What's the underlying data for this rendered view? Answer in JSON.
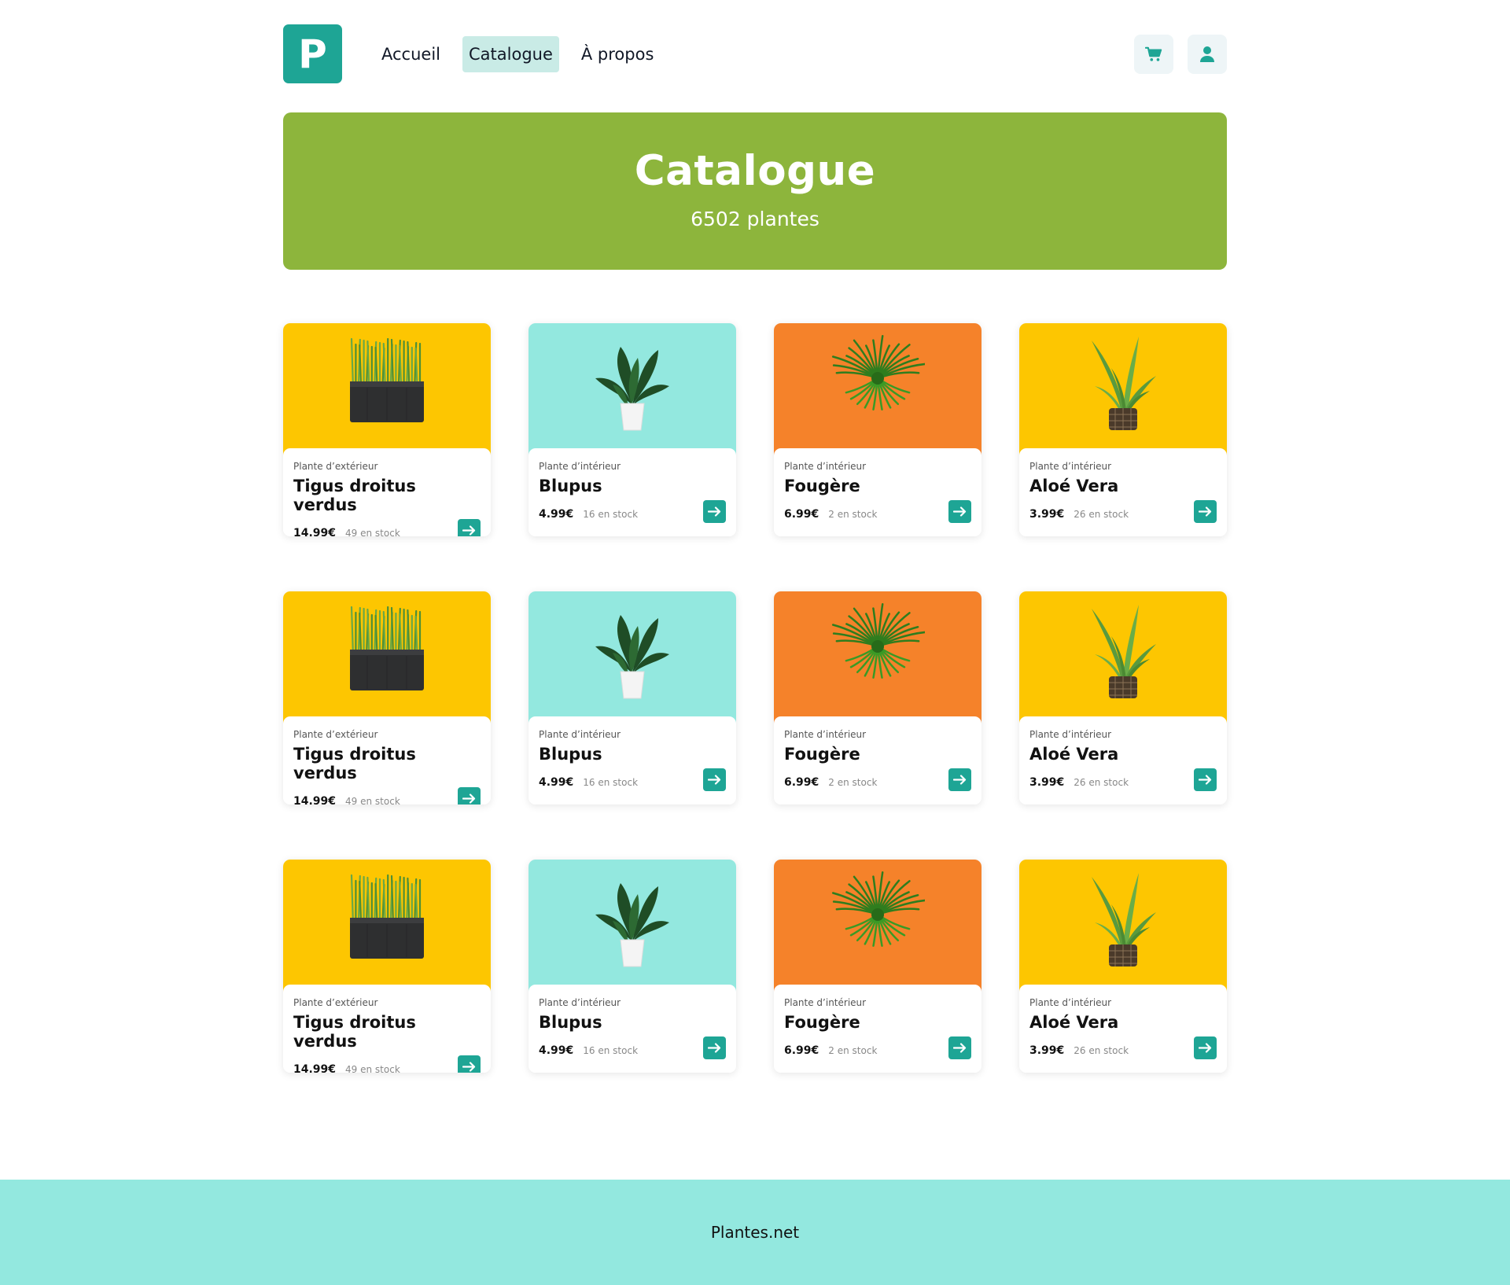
{
  "header": {
    "logo_letter": "P",
    "nav": [
      {
        "label": "Accueil",
        "active": false
      },
      {
        "label": "Catalogue",
        "active": true
      },
      {
        "label": "À propos",
        "active": false
      }
    ],
    "icons": [
      "cart-icon",
      "user-icon"
    ]
  },
  "banner": {
    "title": "Catalogue",
    "subtitle": "6502 plantes"
  },
  "products": [
    {
      "category": "Plante d’extérieur",
      "name": "Tigus droitus verdus",
      "price": "14.99€",
      "stock": "49 en stock",
      "bg": "#fdc601",
      "illustration": "grass-planter"
    },
    {
      "category": "Plante d’intérieur",
      "name": "Blupus",
      "price": "4.99€",
      "stock": "16 en stock",
      "bg": "#93e8df",
      "illustration": "potted-leafy-plant"
    },
    {
      "category": "Plante d’intérieur",
      "name": "Fougère",
      "price": "6.99€",
      "stock": "2 en stock",
      "bg": "#f5822a",
      "illustration": "fern"
    },
    {
      "category": "Plante d’intérieur",
      "name": "Aloé Vera",
      "price": "3.99€",
      "stock": "26 en stock",
      "bg": "#fdc601",
      "illustration": "aloe-vera"
    },
    {
      "category": "Plante d’extérieur",
      "name": "Tigus droitus verdus",
      "price": "14.99€",
      "stock": "49 en stock",
      "bg": "#fdc601",
      "illustration": "grass-planter"
    },
    {
      "category": "Plante d’intérieur",
      "name": "Blupus",
      "price": "4.99€",
      "stock": "16 en stock",
      "bg": "#93e8df",
      "illustration": "potted-leafy-plant"
    },
    {
      "category": "Plante d’intérieur",
      "name": "Fougère",
      "price": "6.99€",
      "stock": "2 en stock",
      "bg": "#f5822a",
      "illustration": "fern"
    },
    {
      "category": "Plante d’intérieur",
      "name": "Aloé Vera",
      "price": "3.99€",
      "stock": "26 en stock",
      "bg": "#fdc601",
      "illustration": "aloe-vera"
    },
    {
      "category": "Plante d’extérieur",
      "name": "Tigus droitus verdus",
      "price": "14.99€",
      "stock": "49 en stock",
      "bg": "#fdc601",
      "illustration": "grass-planter"
    },
    {
      "category": "Plante d’intérieur",
      "name": "Blupus",
      "price": "4.99€",
      "stock": "16 en stock",
      "bg": "#93e8df",
      "illustration": "potted-leafy-plant"
    },
    {
      "category": "Plante d’intérieur",
      "name": "Fougère",
      "price": "6.99€",
      "stock": "2 en stock",
      "bg": "#f5822a",
      "illustration": "fern"
    },
    {
      "category": "Plante d’intérieur",
      "name": "Aloé Vera",
      "price": "3.99€",
      "stock": "26 en stock",
      "bg": "#fdc601",
      "illustration": "aloe-vera"
    }
  ],
  "footer": {
    "text": "Plantes.net"
  },
  "colors": {
    "accent": "#1ea595",
    "banner": "#8db53c",
    "footer": "#93e8df",
    "active_nav": "#c9ebe6"
  }
}
